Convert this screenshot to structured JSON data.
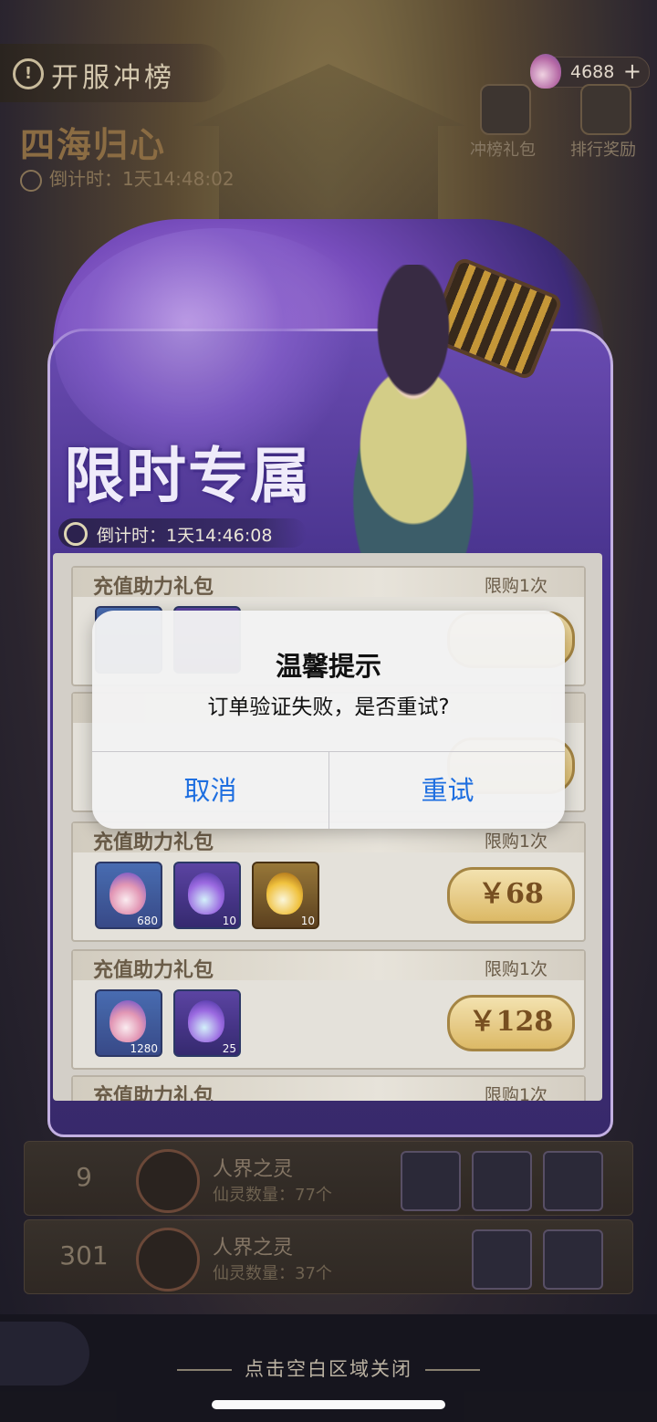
{
  "header": {
    "event_banner": "开服冲榜",
    "event_name": "四海归心",
    "countdown": "倒计时：1天14:48:02"
  },
  "currency": {
    "amount": "4688",
    "plus": "+"
  },
  "top_buttons": [
    "冲榜礼包",
    "排行奖励"
  ],
  "promo": {
    "title": "限时专属",
    "countdown": "倒计时：1天14:46:08"
  },
  "packs": [
    {
      "title": "充值助力礼包",
      "limit": "限购1次",
      "items": [],
      "price": ""
    },
    {
      "title": "",
      "limit": "",
      "items": [],
      "price": ""
    },
    {
      "title": "充值助力礼包",
      "limit": "限购1次",
      "items": [
        {
          "icon": "pink-flame-icon",
          "count": "680"
        },
        {
          "icon": "violet-flame-icon",
          "count": "10"
        },
        {
          "icon": "yellow-flame-icon",
          "count": "10"
        }
      ],
      "price": "￥68"
    },
    {
      "title": "充值助力礼包",
      "limit": "限购1次",
      "items": [
        {
          "icon": "pink-flame-icon",
          "count": "1280"
        },
        {
          "icon": "violet-flame-icon",
          "count": "25"
        }
      ],
      "price": "￥128"
    },
    {
      "title": "充值助力礼包",
      "limit": "限购1次",
      "items": [],
      "price": ""
    }
  ],
  "ranking_rows": [
    {
      "rank": "9",
      "name": "人界之灵",
      "sub": "仙灵数量：77个"
    },
    {
      "rank": "301",
      "name": "人界之灵",
      "sub": "仙灵数量：37个"
    }
  ],
  "dialog": {
    "title": "温馨提示",
    "message": "订单验证失败，是否重试?",
    "cancel": "取消",
    "retry": "重试"
  },
  "footer": {
    "close_hint": "点击空白区域关闭"
  },
  "colors": {
    "accent_blue": "#1f6fe0",
    "panel_purple": "#4a3590",
    "price_gold": "#e1bd69"
  }
}
